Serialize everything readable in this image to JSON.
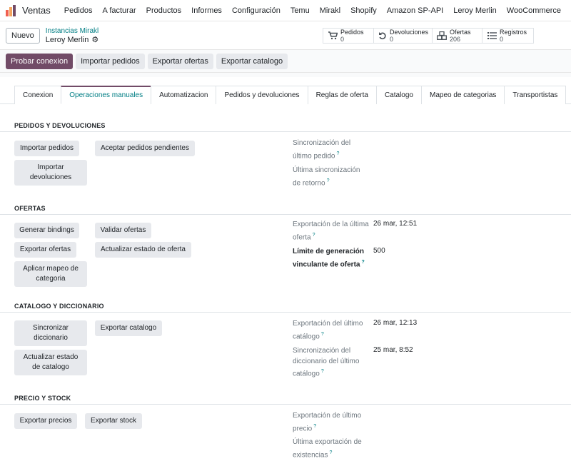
{
  "navbar": {
    "app_title": "Ventas",
    "menu": [
      "Pedidos",
      "A facturar",
      "Productos",
      "Informes",
      "Configuración",
      "Temu",
      "Mirakl",
      "Shopify",
      "Amazon SP-API",
      "Leroy Merlin",
      "WooCommerce"
    ]
  },
  "control": {
    "new_label": "Nuevo",
    "breadcrumb_parent": "Instancias Mirakl",
    "breadcrumb_current": "Leroy Merlin",
    "stats": [
      {
        "label": "Pedidos",
        "value": "0",
        "icon": "cart-icon"
      },
      {
        "label": "Devoluciones",
        "value": "0",
        "icon": "undo-icon"
      },
      {
        "label": "Ofertas",
        "value": "206",
        "icon": "cubes-icon"
      },
      {
        "label": "Registros",
        "value": "0",
        "icon": "list-icon"
      }
    ]
  },
  "actions": [
    "Probar conexion",
    "Importar pedidos",
    "Exportar ofertas",
    "Exportar catalogo"
  ],
  "tabs": [
    "Conexion",
    "Operaciones manuales",
    "Automatizacion",
    "Pedidos y devoluciones",
    "Reglas de oferta",
    "Catalogo",
    "Mapeo de categorias",
    "Transportistas"
  ],
  "active_tab": "Operaciones manuales",
  "sections": {
    "pedidos": {
      "title": "PEDIDOS Y DEVOLUCIONES",
      "buttons": [
        "Importar pedidos",
        "Aceptar pedidos pendientes",
        "Importar devoluciones"
      ],
      "fields": [
        {
          "label": "Sincronización del último pedido",
          "value": ""
        },
        {
          "label": "Última sincronización de retorno",
          "value": ""
        }
      ]
    },
    "ofertas": {
      "title": "OFERTAS",
      "buttons": [
        "Generar bindings",
        "Validar ofertas",
        "Exportar ofertas",
        "Actualizar estado de oferta",
        "Aplicar mapeo de categoria"
      ],
      "fields": [
        {
          "label": "Exportación de la última oferta",
          "value": "26 mar, 12:51"
        },
        {
          "label": "Límite de generación vinculante de oferta",
          "value": "500"
        }
      ]
    },
    "catalogo": {
      "title": "CATALOGO Y DICCIONARIO",
      "buttons": [
        "Sincronizar diccionario",
        "Exportar catalogo",
        "Actualizar estado de catalogo"
      ],
      "fields": [
        {
          "label": "Exportación del último catálogo",
          "value": "26 mar, 12:13"
        },
        {
          "label": "Sincronización del diccionario del último catálogo",
          "value": "25 mar, 8:52"
        }
      ]
    },
    "precio": {
      "title": "PRECIO Y STOCK",
      "buttons": [
        "Exportar precios",
        "Exportar stock"
      ],
      "fields": [
        {
          "label": "Exportación de último precio",
          "value": ""
        },
        {
          "label": "Última exportación de existencias",
          "value": ""
        }
      ]
    }
  },
  "help_mark": "?",
  "colors": {
    "primary": "#714b67",
    "link": "#017e84",
    "button_bg": "#e7e9ed"
  }
}
